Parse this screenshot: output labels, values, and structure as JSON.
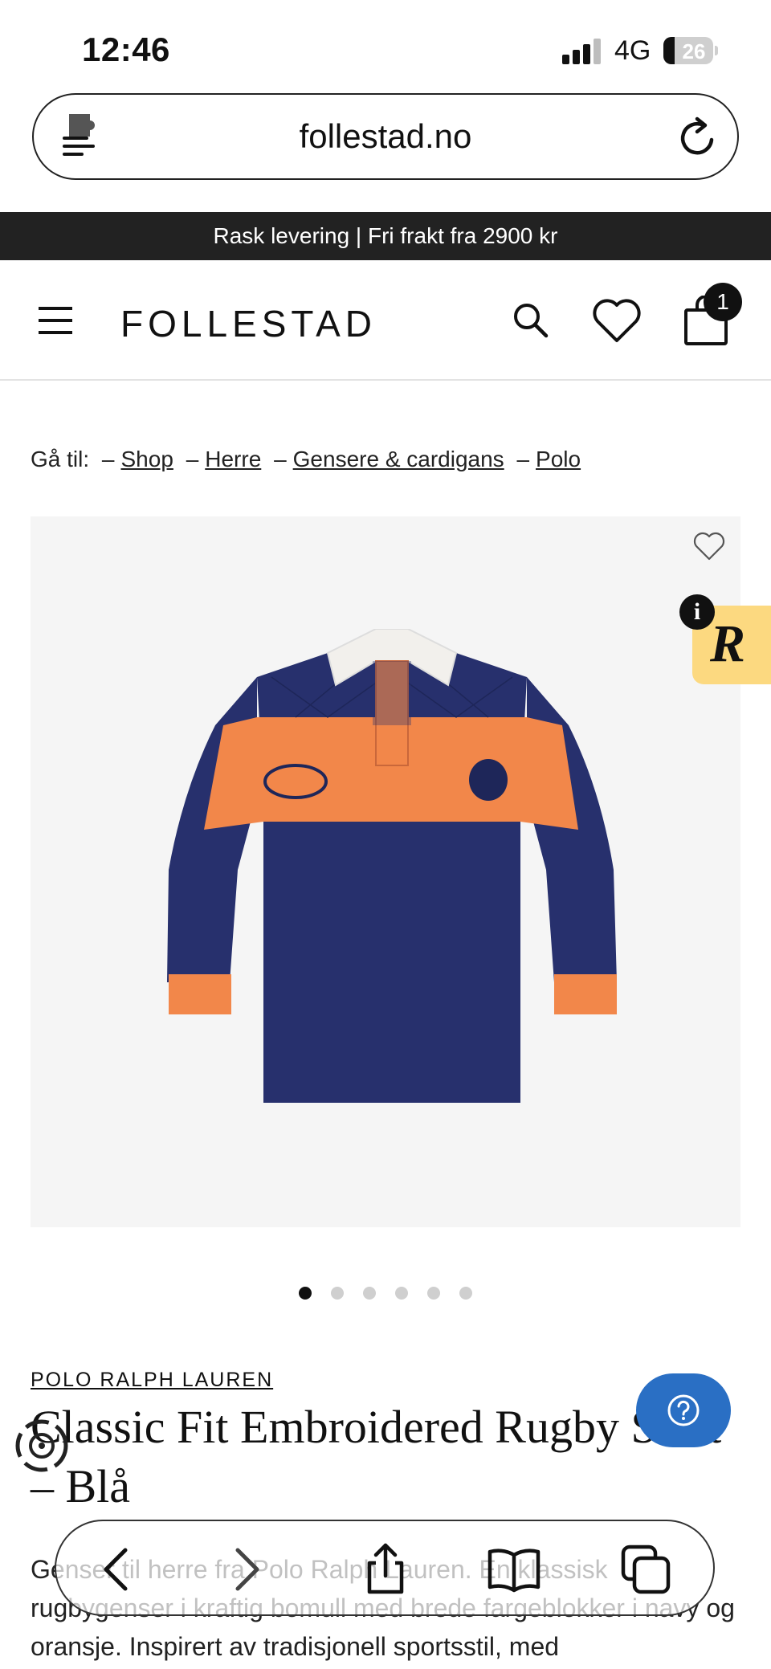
{
  "status_bar": {
    "time": "12:46",
    "network": "4G",
    "battery": "26"
  },
  "browser": {
    "url": "follestad.no"
  },
  "announcement": "Rask levering | Fri frakt fra 2900 kr",
  "header": {
    "logo": "FOLLESTAD",
    "cart_count": "1"
  },
  "breadcrumb": {
    "prefix": "Gå til:",
    "separator": "–",
    "items": [
      "Shop",
      "Herre",
      "Gensere & cardigans",
      "Polo"
    ]
  },
  "product": {
    "brand": "POLO RALPH LAUREN",
    "title": "Classic Fit Embroidered Rugby Shirt – Blå",
    "description": "Genser til herre fra Polo Ralph Lauren. En klassisk rugbygenser i kraftig bomull med brede fargeblokker i navy og oransje. Inspirert av tradisjonell sportsstil, med",
    "image_count": 6,
    "active_image": 0
  },
  "review_widget": {
    "letter": "R",
    "info": "i"
  },
  "help": {
    "label": "?"
  },
  "colors": {
    "navy": "#27306d",
    "orange": "#f2874a",
    "accent_blue": "#2a6fc4",
    "review_yellow": "#fcd980"
  },
  "icons": [
    "extension-icon",
    "reload-icon",
    "menu-icon",
    "search-icon",
    "heart-icon",
    "bag-icon",
    "back-icon",
    "forward-icon",
    "share-icon",
    "bookmarks-icon",
    "tabs-icon"
  ]
}
